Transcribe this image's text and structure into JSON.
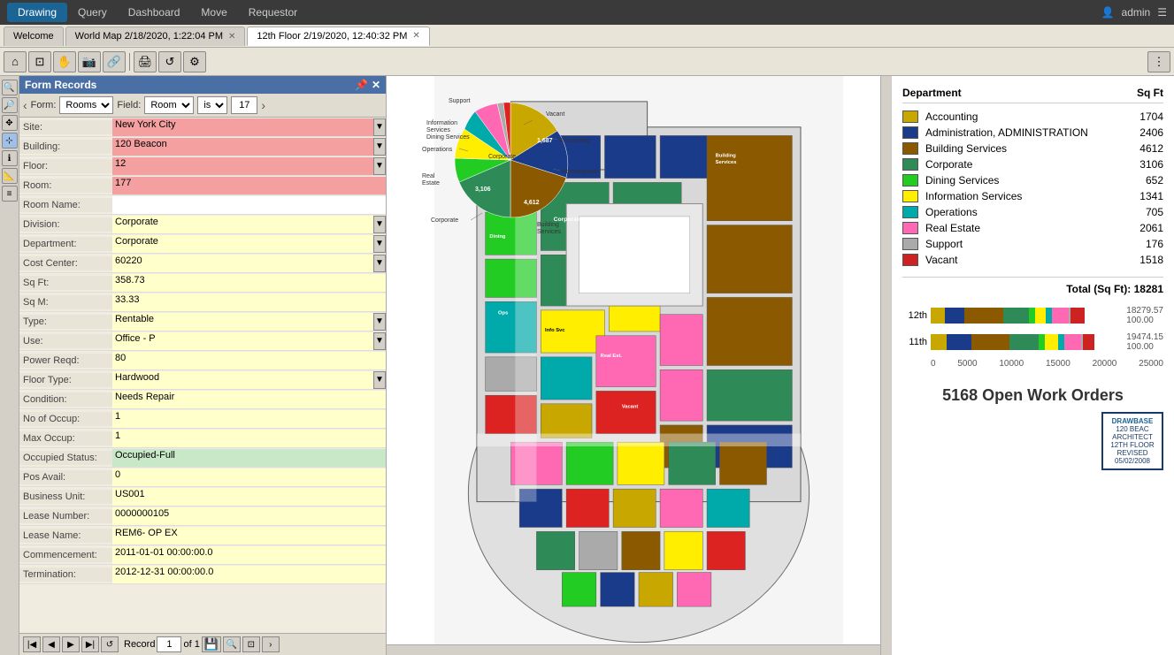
{
  "nav": {
    "items": [
      "Drawing",
      "Query",
      "Dashboard",
      "Move",
      "Requestor"
    ],
    "active": "Drawing",
    "user": "admin"
  },
  "tabs": [
    {
      "label": "Welcome",
      "closeable": false,
      "active": false
    },
    {
      "label": "World Map",
      "date": "2/18/2020, 1:22:04 PM",
      "closeable": true,
      "active": false
    },
    {
      "label": "12th Floor",
      "date": "2/19/2020, 12:40:32 PM",
      "closeable": true,
      "active": true
    }
  ],
  "form": {
    "title": "Form Records",
    "filter": {
      "form_label": "Form:",
      "form_value": "Rooms",
      "field_label": "Field:",
      "field_value": "Room",
      "condition": "is",
      "number": "17"
    },
    "fields": [
      {
        "label": "Site:",
        "value": "New York City",
        "color": "pink",
        "scrollable": true
      },
      {
        "label": "Building:",
        "value": "120 Beacon",
        "color": "pink",
        "scrollable": true
      },
      {
        "label": "Floor:",
        "value": "12",
        "color": "pink",
        "scrollable": true
      },
      {
        "label": "Room:",
        "value": "177",
        "color": "pink",
        "scrollable": false
      },
      {
        "label": "Room Name:",
        "value": "",
        "color": "white",
        "scrollable": false
      },
      {
        "label": "Division:",
        "value": "Corporate",
        "color": "yellow",
        "scrollable": true
      },
      {
        "label": "Department:",
        "value": "Corporate",
        "color": "yellow",
        "scrollable": true
      },
      {
        "label": "Cost Center:",
        "value": "60220",
        "color": "yellow",
        "scrollable": true
      },
      {
        "label": "Sq Ft:",
        "value": "358.73",
        "color": "yellow",
        "scrollable": false
      },
      {
        "label": "Sq M:",
        "value": "33.33",
        "color": "yellow",
        "scrollable": false
      },
      {
        "label": "Type:",
        "value": "Rentable",
        "color": "yellow",
        "scrollable": true
      },
      {
        "label": "Use:",
        "value": "Office - P",
        "color": "yellow",
        "scrollable": true
      },
      {
        "label": "Power Reqd:",
        "value": "80",
        "color": "yellow",
        "scrollable": false
      },
      {
        "label": "Floor Type:",
        "value": "Hardwood",
        "color": "yellow",
        "scrollable": true
      },
      {
        "label": "Condition:",
        "value": "Needs Repair",
        "color": "yellow",
        "scrollable": false
      },
      {
        "label": "No of Occup:",
        "value": "1",
        "color": "yellow",
        "scrollable": false
      },
      {
        "label": "Max Occup:",
        "value": "1",
        "color": "yellow",
        "scrollable": false
      },
      {
        "label": "Occupied Status:",
        "value": "Occupied-Full",
        "color": "green",
        "scrollable": false
      },
      {
        "label": "Pos Avail:",
        "value": "0",
        "color": "yellow",
        "scrollable": false
      },
      {
        "label": "Business Unit:",
        "value": "US001",
        "color": "yellow",
        "scrollable": false
      },
      {
        "label": "Lease Number:",
        "value": "0000000105",
        "color": "yellow",
        "scrollable": false
      },
      {
        "label": "Lease Name:",
        "value": "REM6- OP EX",
        "color": "yellow",
        "scrollable": false
      },
      {
        "label": "Commencement:",
        "value": "2011-01-01 00:00:00.0",
        "color": "yellow",
        "scrollable": false
      },
      {
        "label": "Termination:",
        "value": "2012-12-31 00:00:00.0",
        "color": "yellow",
        "scrollable": false
      }
    ],
    "footer": {
      "record_label": "Record",
      "record_current": "1",
      "record_total": "1"
    }
  },
  "legend": {
    "title": "Department",
    "sq_ft_label": "Sq Ft",
    "items": [
      {
        "name": "Accounting",
        "color": "#b5a000",
        "sqft": 1704
      },
      {
        "name": "Administration, ADMINISTRATION",
        "color": "#1a3a8a",
        "sqft": 2406
      },
      {
        "name": "Building Services",
        "color": "#8b4513",
        "sqft": 4612
      },
      {
        "name": "Corporate",
        "color": "#2e8b57",
        "sqft": 3106
      },
      {
        "name": "Dining Services",
        "color": "#00aa00",
        "sqft": 652
      },
      {
        "name": "Information Services",
        "color": "#eeee00",
        "sqft": 1341
      },
      {
        "name": "Operations",
        "color": "#00aaaa",
        "sqft": 705
      },
      {
        "name": "Real Estate",
        "color": "#ff69b4",
        "sqft": 2061
      },
      {
        "name": "Support",
        "color": "#aaaaaa",
        "sqft": 176
      },
      {
        "name": "Vacant",
        "color": "#cc0000",
        "sqft": 1518
      }
    ],
    "total_label": "Total (Sq Ft):",
    "total_value": "18281"
  },
  "bar_chart": {
    "floors": [
      {
        "label": "12th",
        "total": 18279.57,
        "pct": 100.0,
        "segments": [
          {
            "color": "#b5a000",
            "pct": 9
          },
          {
            "color": "#1a3a8a",
            "pct": 13
          },
          {
            "color": "#8b4513",
            "pct": 25
          },
          {
            "color": "#2e8b57",
            "pct": 17
          },
          {
            "color": "#00aa00",
            "pct": 4
          },
          {
            "color": "#eeee00",
            "pct": 7
          },
          {
            "color": "#00aaaa",
            "pct": 4
          },
          {
            "color": "#ff69b4",
            "pct": 11
          },
          {
            "color": "#aaaaaa",
            "pct": 1
          },
          {
            "color": "#cc0000",
            "pct": 9
          }
        ]
      },
      {
        "label": "11th",
        "total": 19474.15,
        "pct": 100.0,
        "segments": [
          {
            "color": "#b5a000",
            "pct": 10
          },
          {
            "color": "#1a3a8a",
            "pct": 15
          },
          {
            "color": "#8b4513",
            "pct": 23
          },
          {
            "color": "#2e8b57",
            "pct": 18
          },
          {
            "color": "#00aa00",
            "pct": 4
          },
          {
            "color": "#eeee00",
            "pct": 8
          },
          {
            "color": "#00aaaa",
            "pct": 4
          },
          {
            "color": "#ff69b4",
            "pct": 10
          },
          {
            "color": "#aaaaaa",
            "pct": 1
          },
          {
            "color": "#cc0000",
            "pct": 7
          }
        ]
      }
    ],
    "axis": [
      "0",
      "5000",
      "10000",
      "15000",
      "20000",
      "25000"
    ]
  },
  "open_orders": {
    "label": "5168 Open Work Orders"
  },
  "logo": {
    "line1": "DRAWBASE",
    "line2": "120 BEAC",
    "line3": "ARCHITECT",
    "line4": "12TH FLOOR",
    "line5": "REVISED",
    "line6": "05/02/2008"
  },
  "pie_data": {
    "label": "Corporate",
    "slices": [
      {
        "name": "Accounting",
        "value": 1704,
        "color": "#b5a000"
      },
      {
        "name": "Administration",
        "value": 1687,
        "color": "#1a3a8a"
      },
      {
        "name": "Building Services",
        "value": 4612,
        "color": "#8b4513"
      },
      {
        "name": "Corporate",
        "value": 3106,
        "color": "#2e8b57"
      },
      {
        "name": "Dining Services",
        "value": 652,
        "color": "#00aa00"
      },
      {
        "name": "Information Services",
        "value": 1341,
        "color": "#eeee00"
      },
      {
        "name": "Operations",
        "value": 705,
        "color": "#00aaaa"
      },
      {
        "name": "Real Estate",
        "value": 2095,
        "color": "#ff69b4"
      },
      {
        "name": "Support",
        "value": 176,
        "color": "#aaaaaa"
      },
      {
        "name": "Vacant",
        "value": 1518,
        "color": "#cc0000"
      }
    ]
  },
  "toolbar_icons": [
    "home-icon",
    "zoom-fit-icon",
    "hand-icon",
    "camera-icon",
    "link-icon",
    "print-icon",
    "refresh-icon",
    "settings-icon",
    "more-icon"
  ],
  "left_tool_icons": [
    "zoom-in-icon",
    "zoom-out-icon",
    "pan-icon",
    "select-icon",
    "info-icon",
    "measure-icon",
    "layer-icon"
  ]
}
